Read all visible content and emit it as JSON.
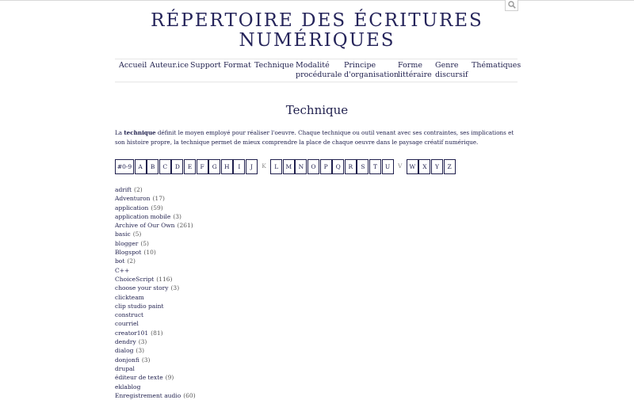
{
  "site": {
    "title_line1": "RÉPERTOIRE DES ÉCRITURES",
    "title_line2": "NUMÉRIQUES"
  },
  "icons": {
    "search": "search-icon"
  },
  "nav": {
    "items": [
      {
        "line1": "Accueil",
        "line2": ""
      },
      {
        "line1": "Auteur.ice",
        "line2": ""
      },
      {
        "line1": "Support",
        "line2": ""
      },
      {
        "line1": "Format",
        "line2": ""
      },
      {
        "line1": "Technique",
        "line2": ""
      },
      {
        "line1": "Modalité",
        "line2": "procédurale"
      },
      {
        "line1": "Principe",
        "line2": "d'organisation"
      },
      {
        "line1": "Forme",
        "line2": "littéraire"
      },
      {
        "line1": "Genre",
        "line2": "discursif"
      },
      {
        "line1": "Thématiques",
        "line2": ""
      }
    ]
  },
  "page": {
    "title": "Technique",
    "intro_prefix": "La ",
    "intro_bold": "technique",
    "intro_rest": " définit le moyen employé pour réaliser l'oeuvre. Chaque technique ou outil venant avec ses contraintes, ses implications et son histoire propre, la technique permet de mieux comprendre la place de chaque oeuvre dans le paysage créatif numérique."
  },
  "letters": [
    {
      "label": "#0-9",
      "enabled": true
    },
    {
      "label": "A",
      "enabled": true
    },
    {
      "label": "B",
      "enabled": true
    },
    {
      "label": "C",
      "enabled": true
    },
    {
      "label": "D",
      "enabled": true
    },
    {
      "label": "E",
      "enabled": true
    },
    {
      "label": "F",
      "enabled": true
    },
    {
      "label": "G",
      "enabled": true
    },
    {
      "label": "H",
      "enabled": true
    },
    {
      "label": "I",
      "enabled": true
    },
    {
      "label": "J",
      "enabled": true
    },
    {
      "label": "K",
      "enabled": false
    },
    {
      "label": "L",
      "enabled": true
    },
    {
      "label": "M",
      "enabled": true
    },
    {
      "label": "N",
      "enabled": true
    },
    {
      "label": "O",
      "enabled": true
    },
    {
      "label": "P",
      "enabled": true
    },
    {
      "label": "Q",
      "enabled": true
    },
    {
      "label": "R",
      "enabled": true
    },
    {
      "label": "S",
      "enabled": true
    },
    {
      "label": "T",
      "enabled": true
    },
    {
      "label": "U",
      "enabled": true
    },
    {
      "label": "V",
      "enabled": false
    },
    {
      "label": "W",
      "enabled": true
    },
    {
      "label": "X",
      "enabled": true
    },
    {
      "label": "Y",
      "enabled": true
    },
    {
      "label": "Z",
      "enabled": true
    }
  ],
  "terms": [
    {
      "name": "adrift",
      "count": "(2)"
    },
    {
      "name": "Adventuron",
      "count": "(17)"
    },
    {
      "name": "application",
      "count": "(59)"
    },
    {
      "name": "application mobile",
      "count": "(3)"
    },
    {
      "name": "Archive of Our Own",
      "count": "(261)"
    },
    {
      "name": "basic",
      "count": "(5)"
    },
    {
      "name": "blogger",
      "count": "(5)"
    },
    {
      "name": "Blogspot",
      "count": "(10)"
    },
    {
      "name": "bot",
      "count": "(2)"
    },
    {
      "name": "C++",
      "count": ""
    },
    {
      "name": "ChoiceScript",
      "count": "(116)"
    },
    {
      "name": "choose your story",
      "count": "(3)"
    },
    {
      "name": "clickteam",
      "count": ""
    },
    {
      "name": "clip studio paint",
      "count": ""
    },
    {
      "name": "construct",
      "count": ""
    },
    {
      "name": "courriel",
      "count": ""
    },
    {
      "name": "creator101",
      "count": "(81)"
    },
    {
      "name": "dendry",
      "count": "(3)"
    },
    {
      "name": "dialog",
      "count": "(3)"
    },
    {
      "name": "donjonfi",
      "count": "(3)"
    },
    {
      "name": "drupal",
      "count": ""
    },
    {
      "name": "éditeur de texte",
      "count": "(9)"
    },
    {
      "name": "eklablog",
      "count": ""
    },
    {
      "name": "Enregistrement audio",
      "count": "(60)"
    }
  ],
  "colors": {
    "text": "#1f1f4d",
    "count": "#555555",
    "disabled": "#8a8a8a",
    "divider": "#e6e6e6"
  }
}
